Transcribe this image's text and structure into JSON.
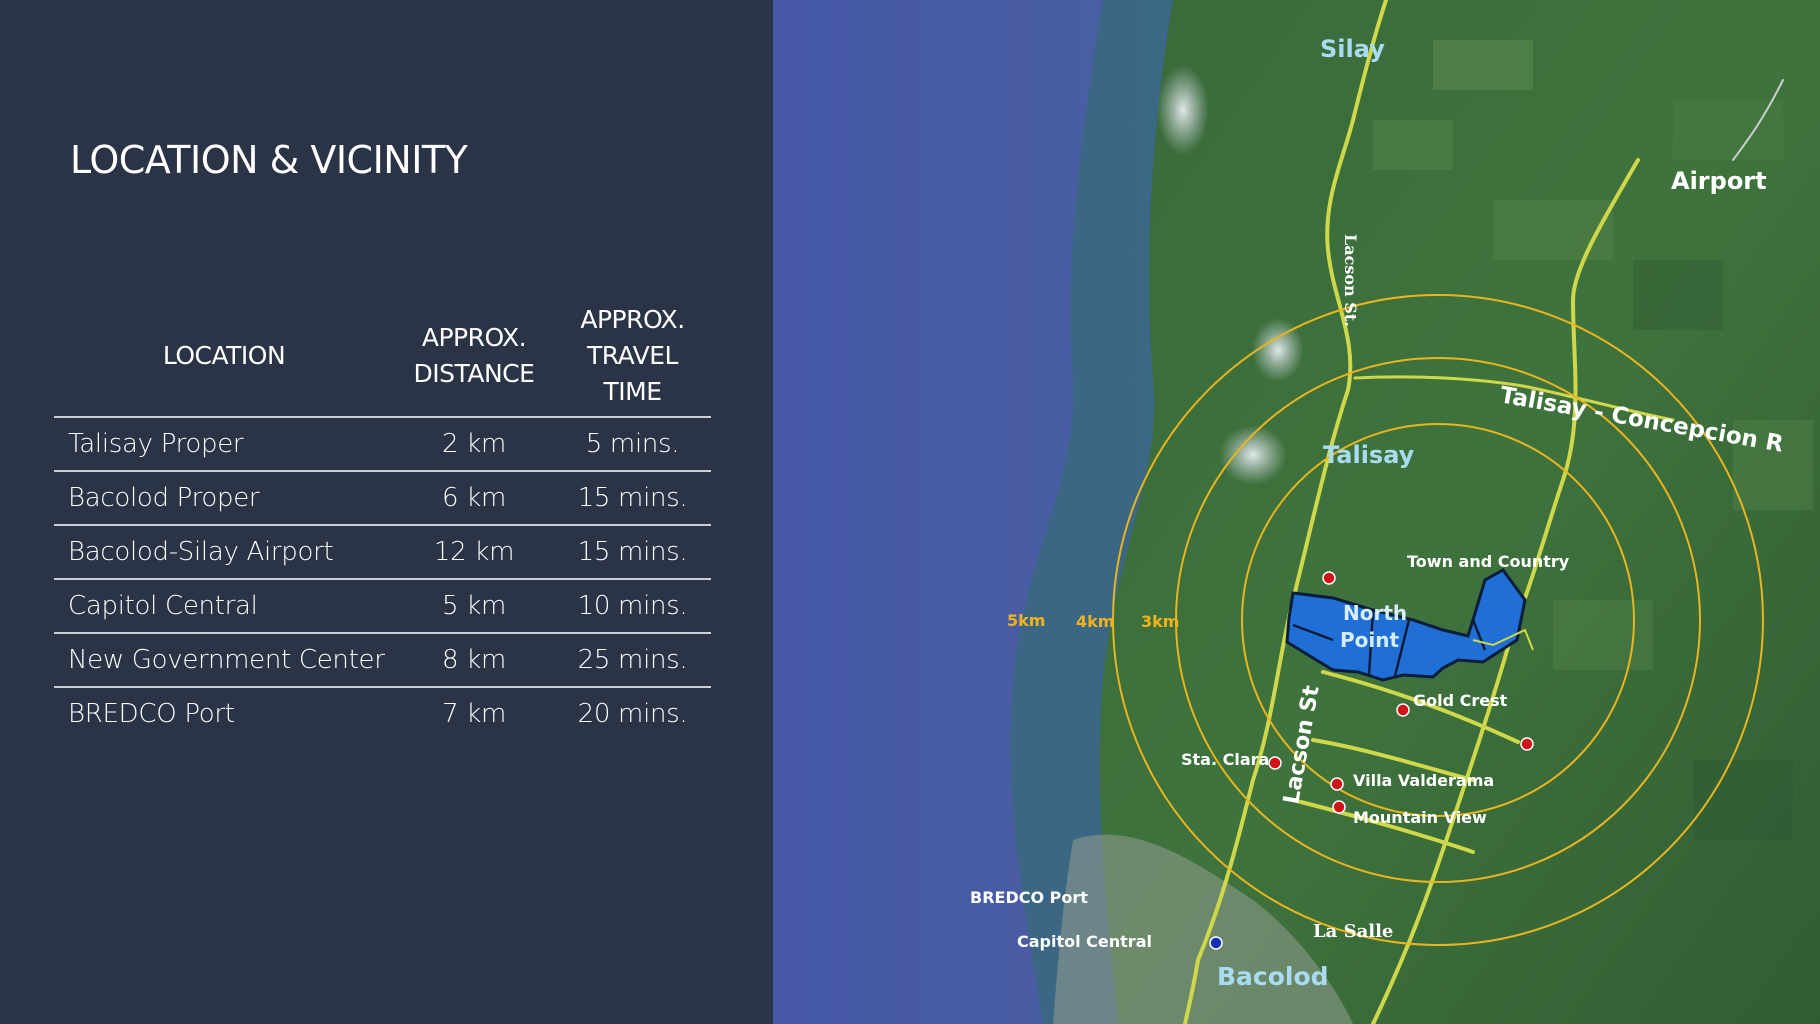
{
  "title": "LOCATION & VICINITY",
  "table": {
    "headers": {
      "location": "LOCATION",
      "distance": [
        "APPROX.",
        "DISTANCE"
      ],
      "time": [
        "APPROX.",
        "TRAVEL",
        "TIME"
      ]
    },
    "rows": [
      {
        "location": "Talisay Proper",
        "distance": "2 km",
        "time": "5 mins."
      },
      {
        "location": "Bacolod Proper",
        "distance": "6 km",
        "time": "15 mins."
      },
      {
        "location": "Bacolod-Silay Airport",
        "distance": "12 km",
        "time": "15 mins."
      },
      {
        "location": "Capitol Central",
        "distance": "5 km",
        "time": "10 mins."
      },
      {
        "location": "New Government Center",
        "distance": "8 km",
        "time": "25 mins."
      },
      {
        "location": "BREDCO Port",
        "distance": "7 km",
        "time": "20 mins."
      }
    ]
  },
  "map": {
    "places": {
      "silay": "Silay",
      "airport": "Airport",
      "talisay": "Talisay",
      "bacolod": "Bacolod",
      "north_point_1": "North",
      "north_point_2": "Point",
      "town_and_country": "Town and Country",
      "gold_crest": "Gold Crest",
      "sta_clara": "Sta. Clara",
      "villa_valderama": "Villa Valderama",
      "mountain_view": "Mountain View",
      "bredco_port": "BREDCO Port",
      "capitol_central": "Capitol Central",
      "la_salle": "La Salle"
    },
    "roads": {
      "lacson_upper": "Lacson St.",
      "lacson_lower": "Lacson St",
      "talisay_concepcion": "Talisay - Concepcion R"
    },
    "rings": [
      "5km",
      "4km",
      "3km"
    ],
    "colors": {
      "sea": "#4a5fa3",
      "land": "#3d6b3a",
      "road": "#cfd84a",
      "ring": "#e8b520",
      "property": "#1f6fd6",
      "poi_red": "#d0141a",
      "poi_blue": "#1530b8",
      "town_label": "#a9dcf0",
      "ring_label": "#f2b21a"
    }
  }
}
